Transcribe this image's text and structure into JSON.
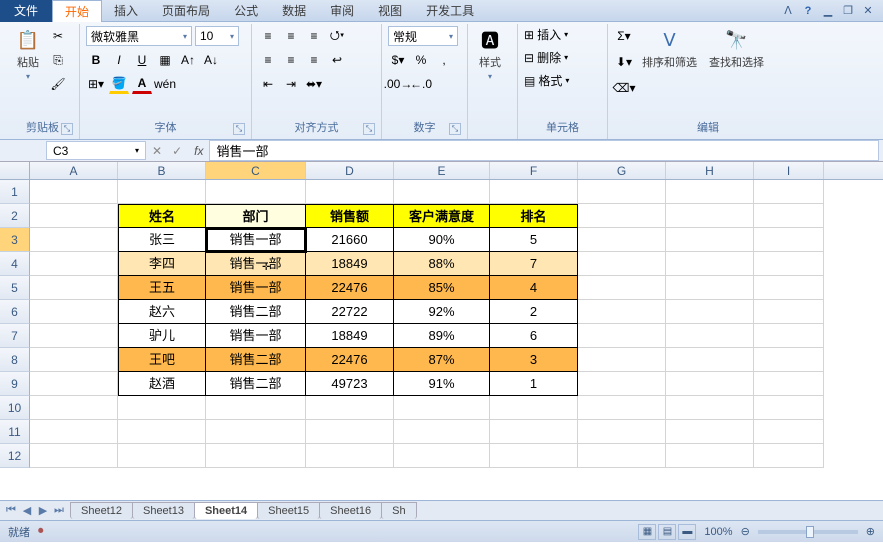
{
  "tabs": {
    "file": "文件",
    "home": "开始",
    "insert": "插入",
    "layout": "页面布局",
    "formulas": "公式",
    "data": "数据",
    "review": "审阅",
    "view": "视图",
    "dev": "开发工具"
  },
  "ribbon": {
    "clipboard": {
      "paste": "粘贴",
      "label": "剪贴板"
    },
    "font": {
      "name": "微软雅黑",
      "size": "10",
      "label": "字体"
    },
    "align": {
      "label": "对齐方式"
    },
    "number": {
      "format": "常规",
      "label": "数字"
    },
    "styles": {
      "btn": "样式"
    },
    "cells": {
      "insert": "插入",
      "delete": "删除",
      "format": "格式",
      "label": "单元格"
    },
    "editing": {
      "sort": "排序和筛选",
      "find": "查找和选择",
      "label": "编辑"
    }
  },
  "namebox": "C3",
  "formula": "销售一部",
  "cols": [
    "A",
    "B",
    "C",
    "D",
    "E",
    "F",
    "G",
    "H",
    "I"
  ],
  "headers": {
    "b": "姓名",
    "c": "部门",
    "d": "销售额",
    "e": "客户满意度",
    "f": "排名"
  },
  "rows": [
    {
      "b": "张三",
      "c": "销售一部",
      "d": "21660",
      "e": "90%",
      "f": "5",
      "cls": ""
    },
    {
      "b": "李四",
      "c": "销售一部",
      "d": "18849",
      "e": "88%",
      "f": "7",
      "cls": "lt"
    },
    {
      "b": "王五",
      "c": "销售一部",
      "d": "22476",
      "e": "85%",
      "f": "4",
      "cls": "dk"
    },
    {
      "b": "赵六",
      "c": "销售二部",
      "d": "22722",
      "e": "92%",
      "f": "2",
      "cls": ""
    },
    {
      "b": "驴儿",
      "c": "销售一部",
      "d": "18849",
      "e": "89%",
      "f": "6",
      "cls": ""
    },
    {
      "b": "王吧",
      "c": "销售二部",
      "d": "22476",
      "e": "87%",
      "f": "3",
      "cls": "dk"
    },
    {
      "b": "赵酒",
      "c": "销售二部",
      "d": "49723",
      "e": "91%",
      "f": "1",
      "cls": ""
    }
  ],
  "sheets": [
    "Sheet12",
    "Sheet13",
    "Sheet14",
    "Sheet15",
    "Sheet16",
    "Sh"
  ],
  "active_sheet": "Sheet14",
  "status": {
    "ready": "就绪",
    "zoom": "100%"
  }
}
